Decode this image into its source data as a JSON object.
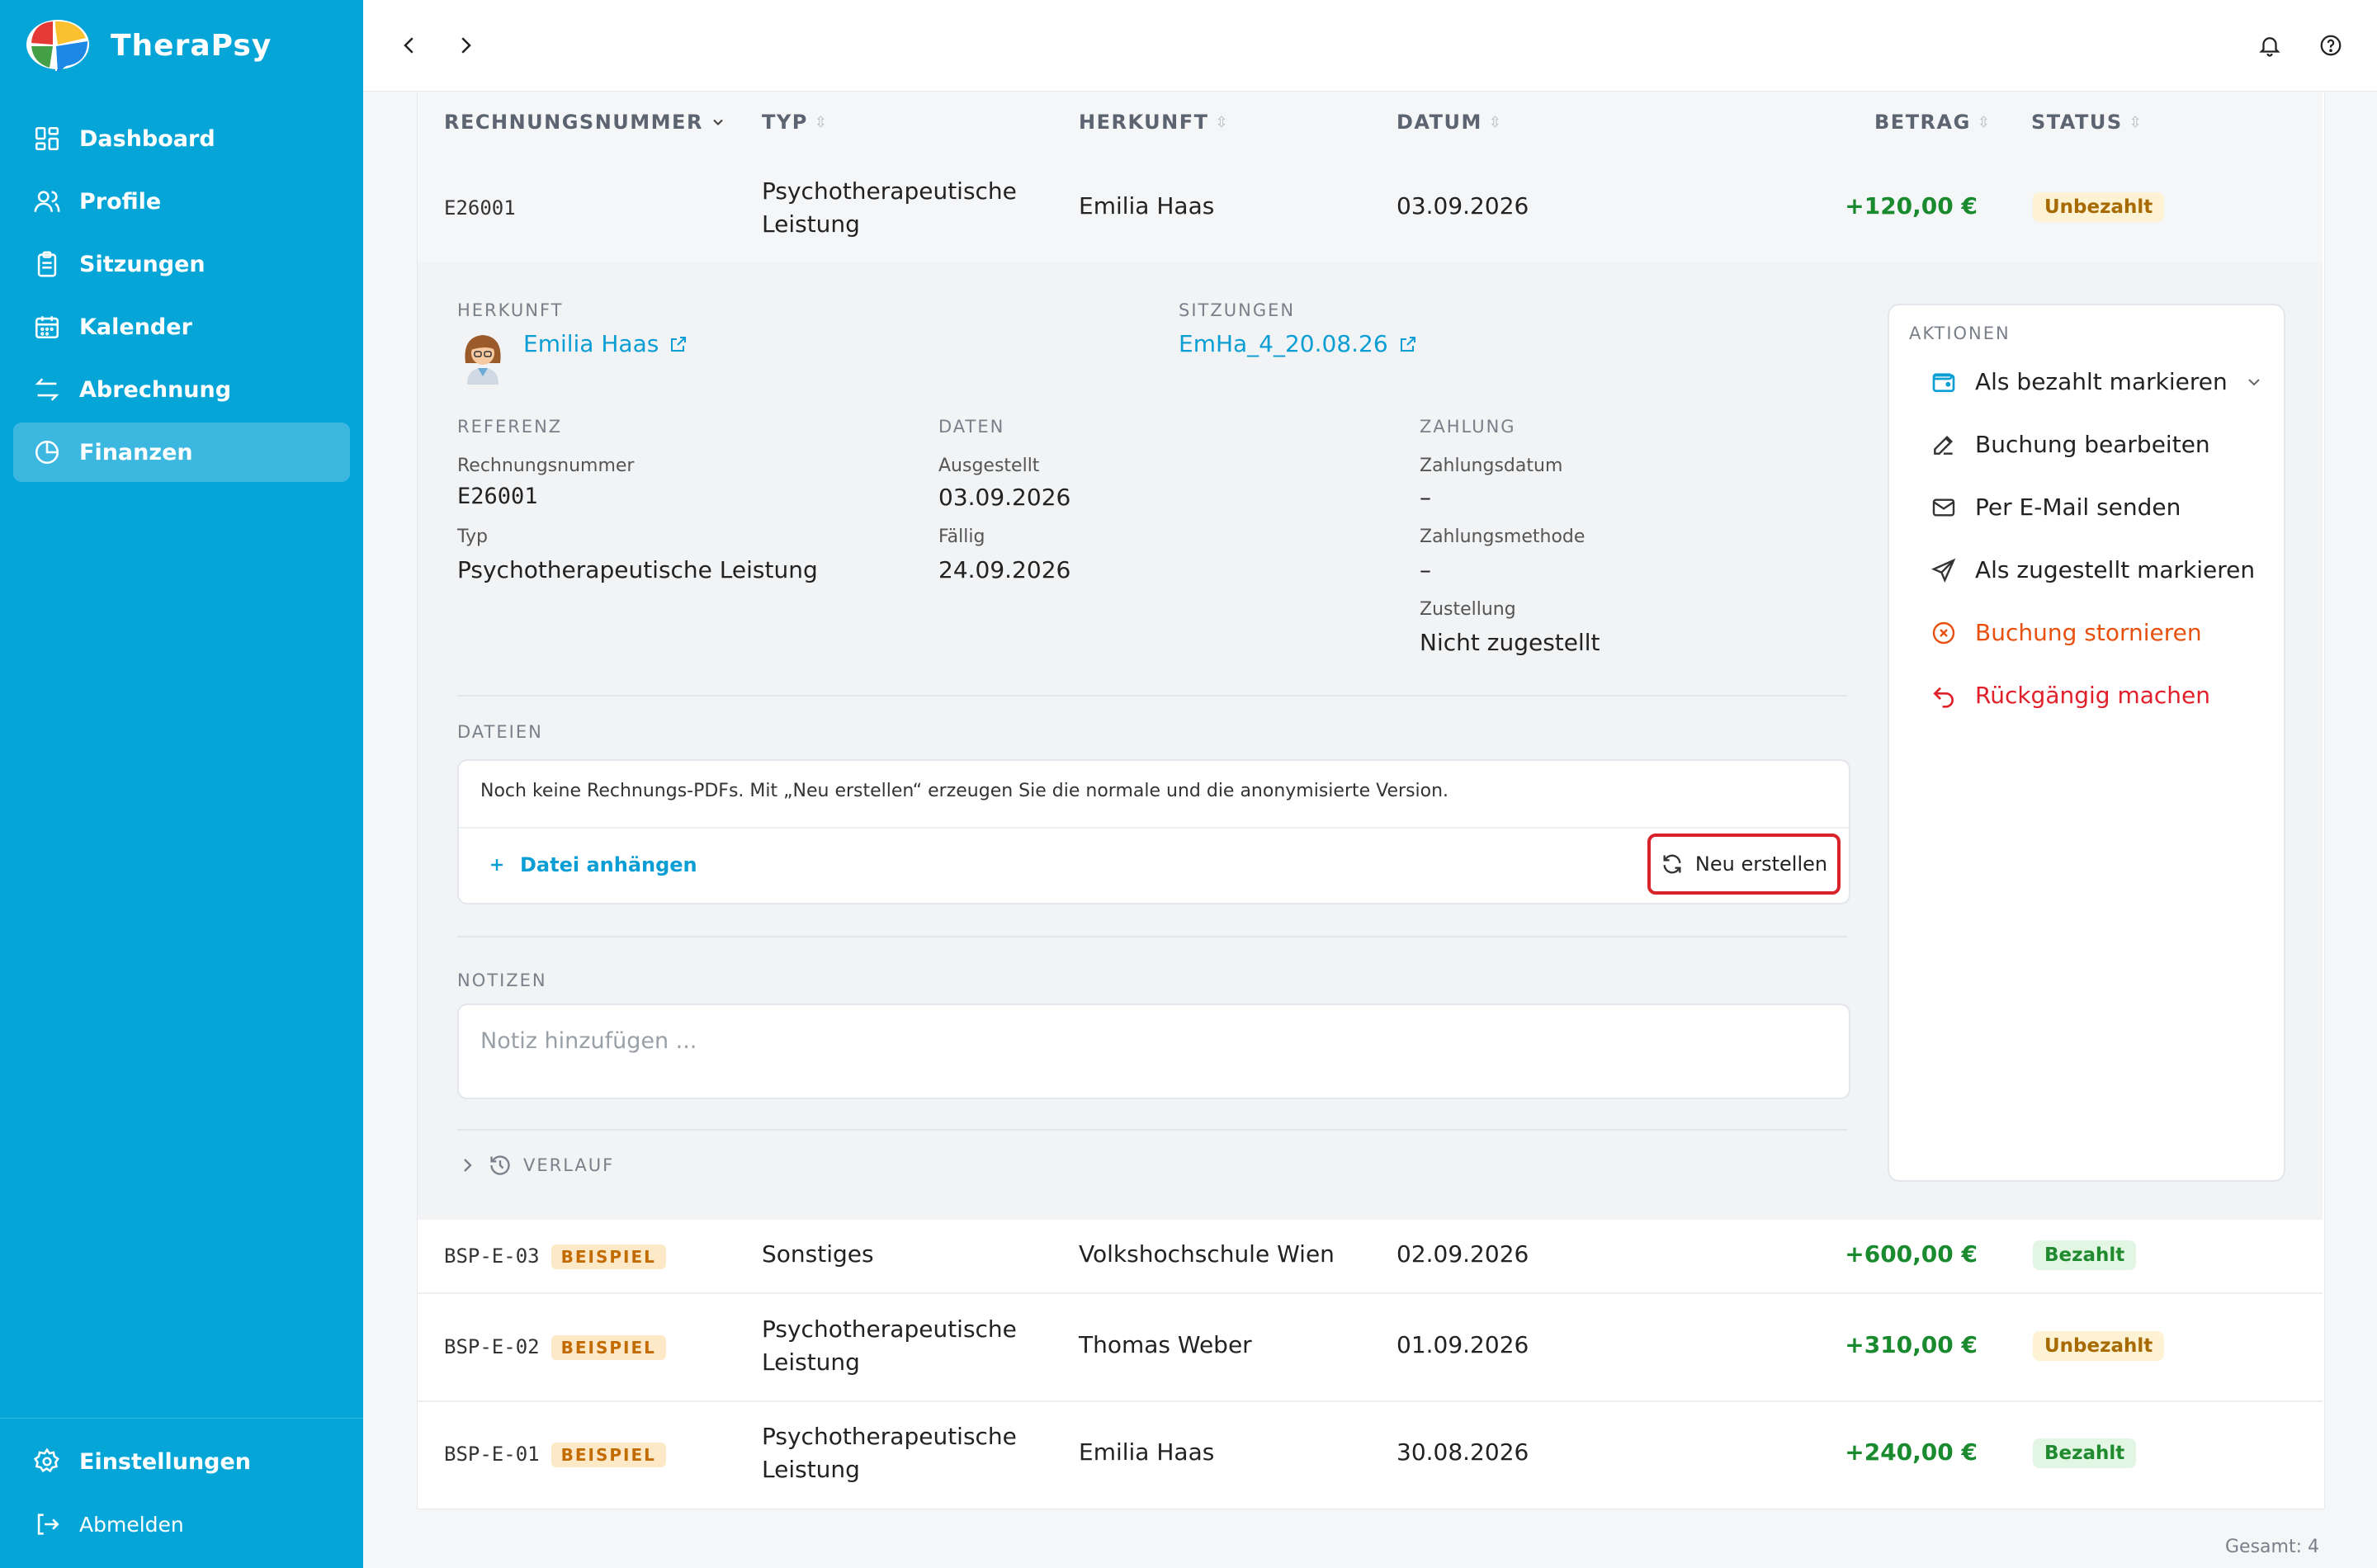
{
  "app": {
    "name": "TheraPsy"
  },
  "sidebar": {
    "items": [
      {
        "label": "Dashboard",
        "icon": "grid-icon"
      },
      {
        "label": "Profile",
        "icon": "users-icon"
      },
      {
        "label": "Sitzungen",
        "icon": "clipboard-icon"
      },
      {
        "label": "Kalender",
        "icon": "calendar-icon"
      },
      {
        "label": "Abrechnung",
        "icon": "arrows-icon"
      },
      {
        "label": "Finanzen",
        "icon": "pie-chart-icon",
        "active": true
      }
    ],
    "settings": "Einstellungen",
    "logout": "Abmelden"
  },
  "table": {
    "headers": {
      "nummer": "RECHNUNGSNUMMER",
      "typ": "TYP",
      "herkunft": "HERKUNFT",
      "datum": "DATUM",
      "betrag": "BETRAG",
      "status": "STATUS"
    },
    "rows": [
      {
        "nummer": "E26001",
        "typ1": "Psychotherapeutische",
        "typ2": "Leistung",
        "herkunft": "Emilia Haas",
        "datum": "03.09.2026",
        "betrag": "+120,00 €",
        "status": "Unbezahlt"
      },
      {
        "nummer": "BSP-E-03",
        "tag": "BEISPIEL",
        "typ1": "Sonstiges",
        "typ2": "",
        "herkunft": "Volkshochschule Wien",
        "datum": "02.09.2026",
        "betrag": "+600,00 €",
        "status": "Bezahlt"
      },
      {
        "nummer": "BSP-E-02",
        "tag": "BEISPIEL",
        "typ1": "Psychotherapeutische",
        "typ2": "Leistung",
        "herkunft": "Thomas Weber",
        "datum": "01.09.2026",
        "betrag": "+310,00 €",
        "status": "Unbezahlt"
      },
      {
        "nummer": "BSP-E-01",
        "tag": "BEISPIEL",
        "typ1": "Psychotherapeutische",
        "typ2": "Leistung",
        "herkunft": "Emilia Haas",
        "datum": "30.08.2026",
        "betrag": "+240,00 €",
        "status": "Bezahlt"
      }
    ],
    "total": "Gesamt: 4"
  },
  "detail": {
    "herkunft_label": "HERKUNFT",
    "herkunft_name": "Emilia Haas",
    "sitzungen_label": "SITZUNGEN",
    "sitzung_ref": "EmHa_4_20.08.26",
    "referenz_label": "REFERENZ",
    "rechnungsnummer_label": "Rechnungsnummer",
    "rechnungsnummer": "E26001",
    "typ_label": "Typ",
    "typ": "Psychotherapeutische Leistung",
    "daten_label": "DATEN",
    "ausgestellt_label": "Ausgestellt",
    "ausgestellt": "03.09.2026",
    "faellig_label": "Fällig",
    "faellig": "24.09.2026",
    "zahlung_label": "ZAHLUNG",
    "zahlungsdatum_label": "Zahlungsdatum",
    "zahlungsdatum": "–",
    "zahlungsmethode_label": "Zahlungsmethode",
    "zahlungsmethode": "–",
    "zustellung_label": "Zustellung",
    "zustellung": "Nicht zugestellt",
    "dateien_label": "DATEIEN",
    "dateien_info": "Noch keine Rechnungs-PDFs. Mit „Neu erstellen“ erzeugen Sie die normale und die anonymisierte Version.",
    "datei_anhaengen": "Datei anhängen",
    "neu_erstellen": "Neu erstellen",
    "notizen_label": "NOTIZEN",
    "notiz_placeholder": "Notiz hinzufügen ...",
    "verlauf_label": "VERLAUF"
  },
  "actions": {
    "label": "AKTIONEN",
    "items": [
      {
        "label": "Als bezahlt markieren",
        "icon": "wallet-icon",
        "color": "#222222"
      },
      {
        "label": "Buchung bearbeiten",
        "icon": "edit-icon",
        "color": "#222222"
      },
      {
        "label": "Per E-Mail senden",
        "icon": "mail-icon",
        "color": "#222222"
      },
      {
        "label": "Als zugestellt markieren",
        "icon": "send-icon",
        "color": "#222222"
      },
      {
        "label": "Buchung stornieren",
        "icon": "cancel-circle-icon",
        "color": "#e8500f"
      },
      {
        "label": "Rückgängig machen",
        "icon": "undo-icon",
        "color": "#e0202a"
      }
    ]
  },
  "colors": {
    "sidebar": "#06a5d8",
    "accent": "#0b9ed4",
    "positive": "#1a8a2e",
    "highlight_border": "#d9232b"
  }
}
